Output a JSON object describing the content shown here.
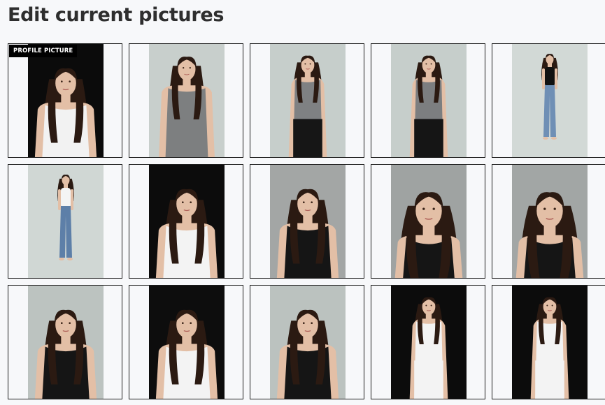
{
  "page": {
    "title": "Edit current pictures",
    "profile_badge": "PROFILE PICTURE"
  },
  "colors": {
    "page_bg": "#f7f8fa",
    "tile_border": "#1d1d1d",
    "badge_bg": "#000000",
    "badge_text": "#ffffff"
  },
  "pictures": [
    {
      "bg": "#0b0b0b",
      "shot": "portrait",
      "top": "#f2f2f2",
      "bottom": "#ffffff",
      "profile": true
    },
    {
      "bg": "#c8cfcc",
      "shot": "half",
      "top": "#7d7f80",
      "bottom": "#7d7f80",
      "profile": false
    },
    {
      "bg": "#c6cecb",
      "shot": "torso",
      "top": "#7f8183",
      "bottom": "#161616",
      "profile": false
    },
    {
      "bg": "#c6cecb",
      "shot": "torso",
      "top": "#7c7e80",
      "bottom": "#151515",
      "profile": false
    },
    {
      "bg": "#d2d9d6",
      "shot": "full",
      "top": "#111111",
      "bottom": "#6f8fb5",
      "profile": false
    },
    {
      "bg": "#d0d7d4",
      "shot": "full",
      "top": "#f4f4f4",
      "bottom": "#5d7fa8",
      "profile": false
    },
    {
      "bg": "#0c0c0c",
      "shot": "portrait",
      "top": "#f3f3f3",
      "bottom": "#f3f3f3",
      "profile": false
    },
    {
      "bg": "#a3a6a5",
      "shot": "portrait",
      "top": "#151515",
      "bottom": "#151515",
      "profile": false
    },
    {
      "bg": "#9fa3a2",
      "shot": "closeup",
      "top": "#151515",
      "bottom": "#151515",
      "profile": false
    },
    {
      "bg": "#a2a6a5",
      "shot": "closeup",
      "top": "#151515",
      "bottom": "#151515",
      "profile": false
    },
    {
      "bg": "#bcc3c0",
      "shot": "portrait",
      "top": "#151515",
      "bottom": "#151515",
      "profile": false
    },
    {
      "bg": "#0d0d0d",
      "shot": "portrait",
      "top": "#f3f3f3",
      "bottom": "#f3f3f3",
      "profile": false
    },
    {
      "bg": "#bbc2bf",
      "shot": "portrait",
      "top": "#151515",
      "bottom": "#151515",
      "profile": false
    },
    {
      "bg": "#0c0c0c",
      "shot": "torso",
      "top": "#f3f3f3",
      "bottom": "#f3f3f3",
      "profile": false
    },
    {
      "bg": "#0c0c0c",
      "shot": "torso",
      "top": "#f3f3f3",
      "bottom": "#f3f3f3",
      "profile": false
    }
  ]
}
